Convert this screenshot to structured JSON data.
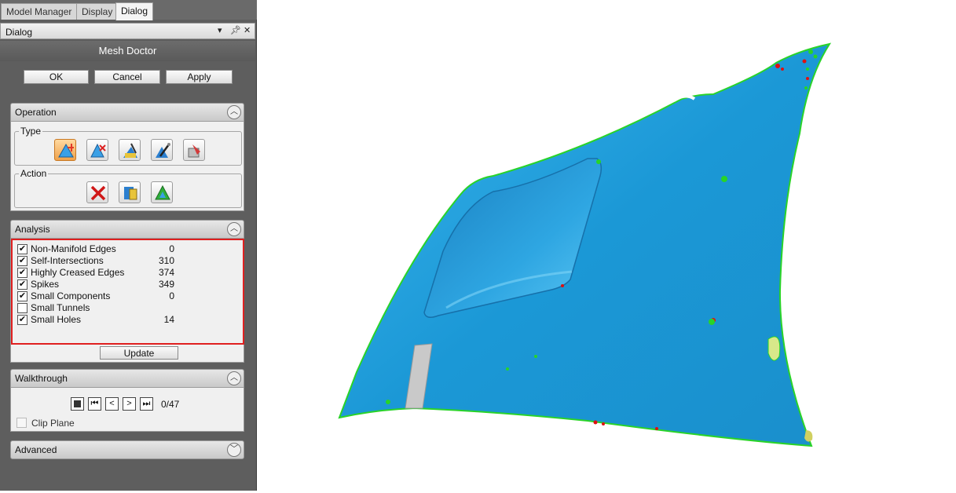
{
  "tabs": [
    "Model Manager",
    "Display",
    "Dialog"
  ],
  "dialog_header": {
    "title": "Dialog",
    "pin_icon": "pin-icon",
    "menu_icon": "dropdown-arrow-icon",
    "close_icon": "close-icon"
  },
  "mesh_doctor": {
    "title": "Mesh Doctor",
    "ok_label": "OK",
    "cancel_label": "Cancel",
    "apply_label": "Apply"
  },
  "operation": {
    "title": "Operation",
    "type_label": "Type",
    "action_label": "Action",
    "type_tools": [
      "auto-repair-icon",
      "delete-selection-icon",
      "smooth-brush-icon",
      "defeature-brush-icon",
      "fill-icon"
    ],
    "action_tools": [
      "delete-icon",
      "fill-holes-icon",
      "refine-icon"
    ]
  },
  "analysis": {
    "title": "Analysis",
    "rows": [
      {
        "label": "Non-Manifold Edges",
        "count": "0",
        "checked": true
      },
      {
        "label": "Self-Intersections",
        "count": "310",
        "checked": true
      },
      {
        "label": "Highly Creased Edges",
        "count": "374",
        "checked": true
      },
      {
        "label": "Spikes",
        "count": "349",
        "checked": true
      },
      {
        "label": "Small Components",
        "count": "0",
        "checked": true
      },
      {
        "label": "Small Tunnels",
        "count": "",
        "checked": false
      },
      {
        "label": "Small Holes",
        "count": "14",
        "checked": true
      }
    ],
    "update_label": "Update",
    "highlight_color": "#e02020"
  },
  "walkthrough": {
    "title": "Walkthrough",
    "counter": "0/47",
    "clip_plane_label": "Clip Plane",
    "clip_plane_checked": false
  },
  "advanced": {
    "title": "Advanced"
  },
  "colors": {
    "panel_bg": "#5e5e5e",
    "mesh_blue": "#1e9ad8",
    "issue_green": "#22cc22",
    "issue_red": "#e01010"
  }
}
